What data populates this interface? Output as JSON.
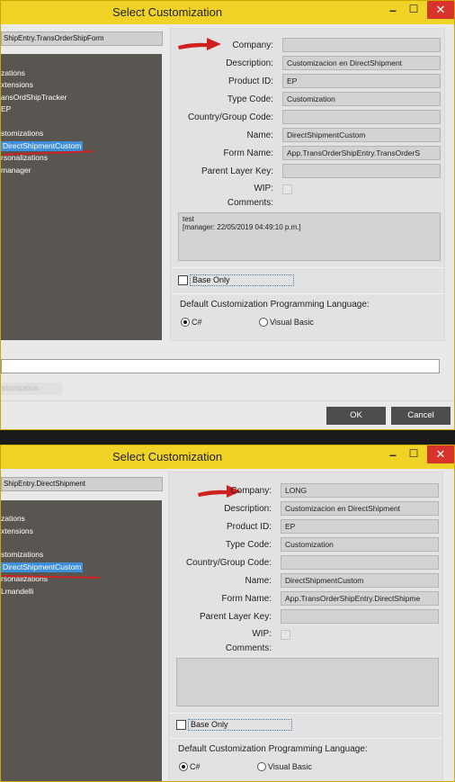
{
  "colors": {
    "titlebar": "#f1d327",
    "tree_bg": "#595651",
    "selection": "#3c8fd8",
    "close": "#d9342b",
    "annotation": "#d02020"
  },
  "dialog1": {
    "title": "Select Customization",
    "minimize": "–",
    "maximize": "☐",
    "close": "✕",
    "path": "ShipEntry.TransOrderShipForm",
    "tree": [
      "zations",
      "xtensions",
      "ansOrdShipTracker",
      " EP",
      "stomizations",
      "DirectShipmentCustom",
      "rsonalizations",
      " manager"
    ],
    "labels": {
      "company": "Company:",
      "description": "Description:",
      "product": "Product ID:",
      "type": "Type Code:",
      "country": "Country/Group Code:",
      "name": "Name:",
      "form": "Form Name:",
      "parent": "Parent Layer Key:",
      "wip": "WIP:",
      "comments": "Comments:"
    },
    "values": {
      "company": "",
      "description": "Customizacion en DirectShipment",
      "product": "EP",
      "type": "Customization",
      "country": "",
      "name": "DirectShipmentCustom",
      "form": "App.TransOrderShipEntry.TransOrderS",
      "parent": ""
    },
    "comments": [
      "test",
      "[manager: 22/05/2019 04:49:10 p.m.]"
    ],
    "base_only": "Base Only",
    "lang_label": "Default Customization Programming Language:",
    "lang_cs": "C#",
    "lang_vb": "Visual Basic",
    "bottom_input": "",
    "dim_text": "stomization",
    "ok": "OK",
    "cancel": "Cancel"
  },
  "dialog2": {
    "title": "Select Customization",
    "minimize": "–",
    "maximize": "☐",
    "close": "✕",
    "path": "ShipEntry.DirectShipment",
    "tree": [
      "zations",
      "xtensions",
      "stomizations",
      "DirectShipmentCustom",
      "rsonalizations",
      " Lmandelli"
    ],
    "labels": {
      "company": "Company:",
      "description": "Description:",
      "product": "Product ID:",
      "type": "Type Code:",
      "country": "Country/Group Code:",
      "name": "Name:",
      "form": "Form Name:",
      "parent": "Parent Layer Key:",
      "wip": "WIP:",
      "comments": "Comments:"
    },
    "values": {
      "company": "LONG",
      "description": "Customizacion en DirectShipment",
      "product": "EP",
      "type": "Customization",
      "country": "",
      "name": "DirectShipmentCustom",
      "form": "App.TransOrderShipEntry.DirectShipme",
      "parent": ""
    },
    "comments": [
      "",
      ""
    ],
    "base_only": "Base Only",
    "lang_label": "Default Customization Programming Language:",
    "lang_cs": "C#",
    "lang_vb": "Visual Basic"
  }
}
